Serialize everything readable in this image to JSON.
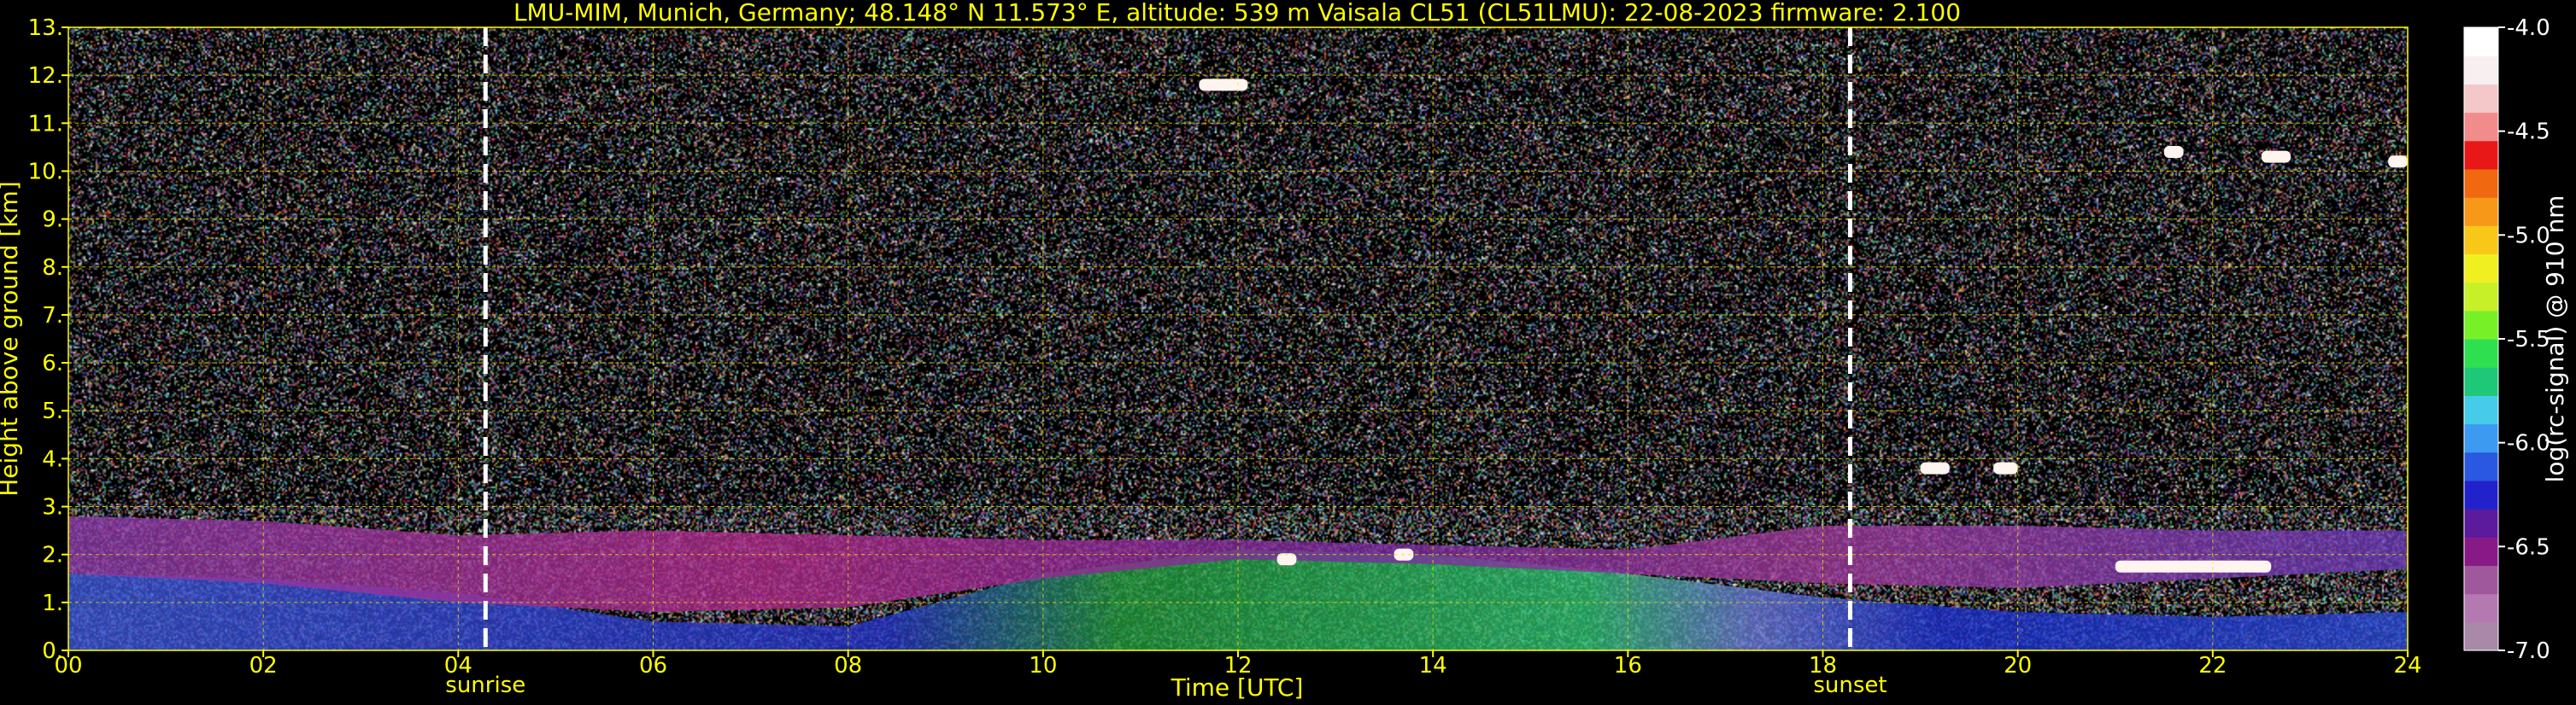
{
  "chart_data": {
    "type": "heatmap",
    "title": "LMU-MIM, Munich, Germany; 48.148° N 11.573° E, altitude: 539 m    Vaisala CL51 (CL51LMU): 22-08-2023    firmware: 2.100",
    "xlabel": "Time [UTC]",
    "ylabel": "Height above ground [km]",
    "xlim": [
      0,
      24
    ],
    "ylim": [
      0,
      13
    ],
    "x_ticks": [
      "00",
      "02",
      "04",
      "06",
      "08",
      "10",
      "12",
      "14",
      "16",
      "18",
      "20",
      "22",
      "24"
    ],
    "y_ticks": [
      "0.",
      "1.",
      "2.",
      "3.",
      "4.",
      "5.",
      "6.",
      "7.",
      "8.",
      "9.",
      "10.",
      "11.",
      "12.",
      "13."
    ],
    "grid": true,
    "annotations": [
      {
        "label": "sunrise",
        "x": 4.28
      },
      {
        "label": "sunset",
        "x": 18.28
      }
    ],
    "colorbar": {
      "label": "log(rc-signal) @ 910 nm",
      "min": -7.0,
      "max": -4.0,
      "ticks": [
        "-4.0",
        "-4.5",
        "-5.0",
        "-5.5",
        "-6.0",
        "-6.5",
        "-7.0"
      ],
      "tick_values": [
        -4.0,
        -4.5,
        -5.0,
        -5.5,
        -6.0,
        -6.5,
        -7.0
      ],
      "colors": [
        "#a88aa8",
        "#b479b0",
        "#a0589c",
        "#881a88",
        "#5c1a9c",
        "#2222cc",
        "#2a58e0",
        "#3c9af0",
        "#46cce8",
        "#1ec878",
        "#2ee050",
        "#78f028",
        "#c8f028",
        "#f0f020",
        "#f8c818",
        "#f89818",
        "#f06810",
        "#e81818",
        "#f08c8c",
        "#f4c8c8",
        "#f8f0f0",
        "#ffffff"
      ]
    },
    "layers": [
      {
        "name": "surface-aerosol",
        "x": [
          0,
          24
        ],
        "bottom_km": 0.0,
        "top_km": [
          1.6,
          1.5,
          1.2,
          0.6,
          0.5,
          1.6,
          2.1,
          2.0,
          1.6,
          1.1,
          0.8,
          0.7,
          0.8
        ]
      },
      {
        "name": "residual-layer",
        "x": [
          0,
          24
        ],
        "bottom_km": [
          1.6,
          1.4,
          1.0,
          0.8,
          0.9,
          1.5,
          1.9,
          1.8,
          1.6,
          1.4,
          1.3,
          1.5,
          1.7
        ],
        "top_km": [
          2.8,
          2.7,
          2.4,
          2.5,
          2.4,
          2.3,
          2.3,
          2.2,
          2.1,
          2.6,
          2.6,
          2.5,
          2.5
        ]
      }
    ],
    "clouds": [
      {
        "x": [
          19.0,
          19.3
        ],
        "height_km": 3.8
      },
      {
        "x": [
          19.75,
          20.0
        ],
        "height_km": 3.8
      },
      {
        "x": [
          12.4,
          12.6
        ],
        "height_km": 1.9
      },
      {
        "x": [
          13.6,
          13.8
        ],
        "height_km": 2.0
      },
      {
        "x": [
          21.0,
          22.6
        ],
        "height_km": 1.75
      },
      {
        "x": [
          21.5,
          21.7
        ],
        "height_km": 10.4
      },
      {
        "x": [
          22.5,
          22.8
        ],
        "height_km": 10.3
      },
      {
        "x": [
          23.8,
          24.0
        ],
        "height_km": 10.2
      },
      {
        "x": [
          11.6,
          12.1
        ],
        "height_km": 11.8
      }
    ]
  }
}
